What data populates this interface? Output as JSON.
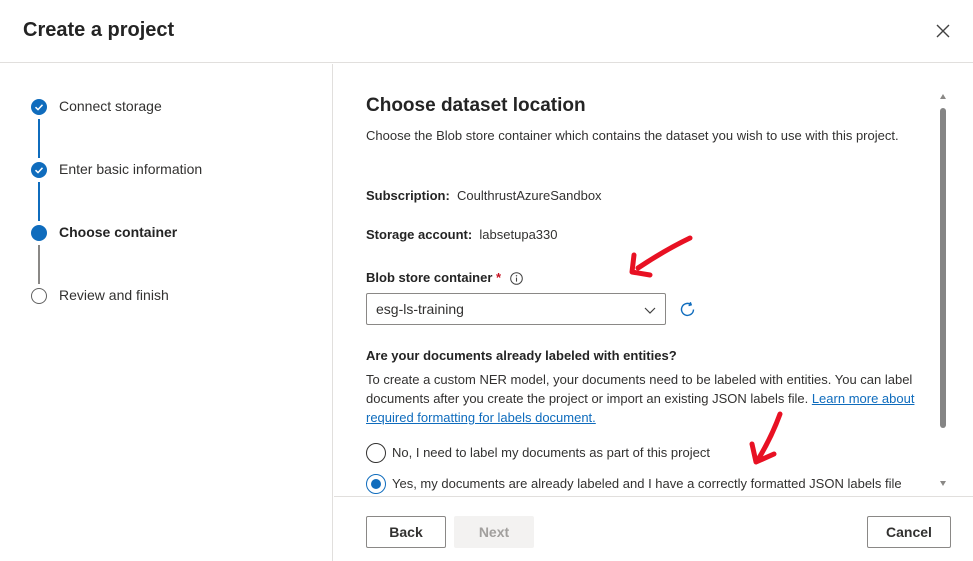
{
  "header": {
    "title": "Create a project"
  },
  "steps": [
    {
      "label": "Connect storage",
      "state": "done"
    },
    {
      "label": "Enter basic information",
      "state": "done"
    },
    {
      "label": "Choose container",
      "state": "current"
    },
    {
      "label": "Review and finish",
      "state": "pending"
    }
  ],
  "content": {
    "heading": "Choose dataset location",
    "description": "Choose the Blob store container which contains the dataset you wish to use with this project.",
    "subscription": {
      "label": "Subscription:",
      "value": "CoulthrustAzureSandbox"
    },
    "storage_account": {
      "label": "Storage account:",
      "value": "labsetupa330"
    },
    "blob_container": {
      "label": "Blob store container",
      "required_mark": "*",
      "selected": "esg-ls-training"
    },
    "question": "Are your documents already labeled with entities?",
    "paragraph_text": "To create a custom NER model, your documents need to be labeled with entities. You can label documents after you create the project or import an existing JSON labels file. ",
    "paragraph_link": "Learn more about required formatting for labels document.",
    "radio_options": [
      {
        "label": "No, I need to label my documents as part of this project",
        "selected": false
      },
      {
        "label": "Yes, my documents are already labeled and I have a correctly formatted JSON labels file",
        "selected": true
      }
    ]
  },
  "footer": {
    "back": "Back",
    "next": "Next",
    "cancel": "Cancel"
  },
  "colors": {
    "accent": "#0f6cbd",
    "annotation": "#e81123",
    "required": "#c50f1f"
  }
}
